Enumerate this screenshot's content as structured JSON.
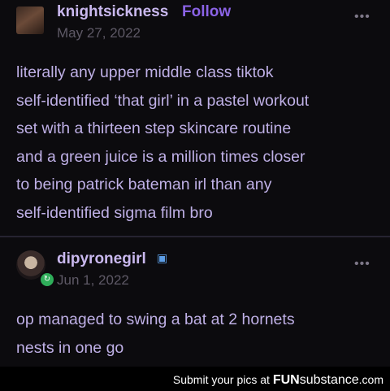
{
  "posts": [
    {
      "username": "knightsickness",
      "follow_label": "Follow",
      "date": "May 27, 2022",
      "more_icon": "•••",
      "lines": [
        "literally any upper middle class tiktok",
        "self-identified ‘that girl’ in a pastel workout",
        "set with a thirteen step skincare routine",
        "and a green juice is a million times closer",
        "to being patrick bateman irl than any",
        "self-identified sigma film bro"
      ]
    },
    {
      "username": "dipyronegirl",
      "blog_icon": "▣",
      "badge_icon": "↻",
      "date": "Jun 1, 2022",
      "more_icon": "•••",
      "lines": [
        "op managed to swing a bat at 2 hornets",
        "nests in one go"
      ]
    }
  ],
  "footer": {
    "prefix": "Submit your pics at ",
    "brand_bold": "FUN",
    "brand_rest": "substance",
    "suffix": ".com"
  }
}
